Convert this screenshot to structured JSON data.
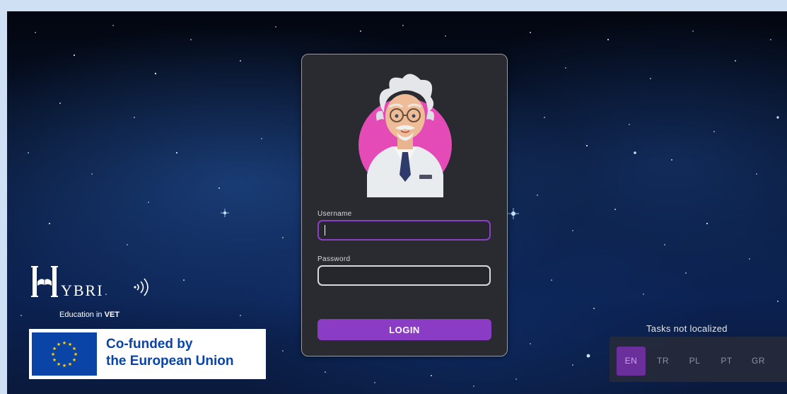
{
  "login_form": {
    "username_label": "Username",
    "username_value": "",
    "password_label": "Password",
    "password_value": "",
    "login_label": "LOGIN"
  },
  "brand": {
    "logo_text": "YBRI",
    "subtitle_prefix": "Education in ",
    "subtitle_emphasis": "VET"
  },
  "eu_banner": {
    "line1": "Co-funded by",
    "line2": "the European Union"
  },
  "localization": {
    "note": "Tasks not localized",
    "languages": [
      {
        "code": "EN",
        "active": true
      },
      {
        "code": "TR",
        "active": false
      },
      {
        "code": "PL",
        "active": false
      },
      {
        "code": "PT",
        "active": false
      },
      {
        "code": "GR",
        "active": false
      }
    ]
  },
  "colors": {
    "accent": "#8a3dc4",
    "card": "#2a2b30",
    "avatar_circle": "#e54bb6",
    "eu_blue": "#0a44a6",
    "eu_star": "#ffd617"
  },
  "icons": [
    "scientist-avatar",
    "hybrid-logo",
    "eu-flag-icon"
  ]
}
